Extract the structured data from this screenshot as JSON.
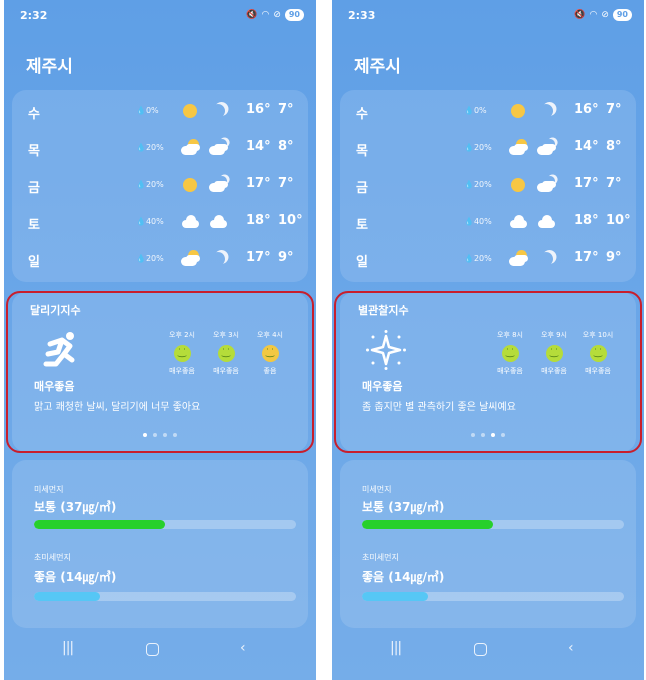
{
  "screens": [
    {
      "status": {
        "time": "2:32",
        "battery": "90"
      },
      "city": "제주시",
      "forecast": [
        {
          "day": "수",
          "rain": "0%",
          "day_icon": "sun-icon",
          "night_icon": "moon-icon",
          "high": "16°",
          "low": "7°"
        },
        {
          "day": "목",
          "rain": "20%",
          "day_icon": "partly-cloudy-icon",
          "night_icon": "cloudy-night-icon",
          "high": "14°",
          "low": "8°"
        },
        {
          "day": "금",
          "rain": "20%",
          "day_icon": "sun-icon",
          "night_icon": "cloudy-night-icon",
          "high": "17°",
          "low": "7°"
        },
        {
          "day": "토",
          "rain": "40%",
          "day_icon": "cloud-icon",
          "night_icon": "cloud-icon",
          "high": "18°",
          "low": "10°"
        },
        {
          "day": "일",
          "rain": "20%",
          "day_icon": "partly-cloudy-icon",
          "night_icon": "moon-icon",
          "high": "17°",
          "low": "9°"
        }
      ],
      "index": {
        "title": "달리기지수",
        "icon": "running-person-icon",
        "slots": [
          {
            "time": "오후 2시",
            "level": "매우좋음"
          },
          {
            "time": "오후 3시",
            "level": "매우좋음"
          },
          {
            "time": "오후 4시",
            "level": "좋음"
          }
        ],
        "verdict": "매우좋음",
        "description": "맑고 쾌청한 날씨, 달리기에 너무 좋아요",
        "page": 1,
        "pages": 4
      },
      "dust": {
        "pm10_label": "미세먼지",
        "pm10_value": "보통 (37㎍/㎥)",
        "pm10_level": 0.5,
        "pm25_label": "초미세먼지",
        "pm25_value": "좋음 (14㎍/㎥)",
        "pm25_level": 0.25
      }
    },
    {
      "status": {
        "time": "2:33",
        "battery": "90"
      },
      "city": "제주시",
      "forecast": [
        {
          "day": "수",
          "rain": "0%",
          "day_icon": "sun-icon",
          "night_icon": "moon-icon",
          "high": "16°",
          "low": "7°"
        },
        {
          "day": "목",
          "rain": "20%",
          "day_icon": "partly-cloudy-icon",
          "night_icon": "cloudy-night-icon",
          "high": "14°",
          "low": "8°"
        },
        {
          "day": "금",
          "rain": "20%",
          "day_icon": "sun-icon",
          "night_icon": "cloudy-night-icon",
          "high": "17°",
          "low": "7°"
        },
        {
          "day": "토",
          "rain": "40%",
          "day_icon": "cloud-icon",
          "night_icon": "cloud-icon",
          "high": "18°",
          "low": "10°"
        },
        {
          "day": "일",
          "rain": "20%",
          "day_icon": "partly-cloudy-icon",
          "night_icon": "moon-icon",
          "high": "17°",
          "low": "9°"
        }
      ],
      "index": {
        "title": "별관찰지수",
        "icon": "sparkle-star-icon",
        "slots": [
          {
            "time": "오후 8시",
            "level": "매우좋음"
          },
          {
            "time": "오후 9시",
            "level": "매우좋음"
          },
          {
            "time": "오후 10시",
            "level": "매우좋음"
          }
        ],
        "verdict": "매우좋음",
        "description": "좀 춥지만 별 관측하기 좋은 날씨예요",
        "page": 3,
        "pages": 4
      },
      "dust": {
        "pm10_label": "미세먼지",
        "pm10_value": "보통 (37㎍/㎥)",
        "pm10_level": 0.5,
        "pm25_label": "초미세먼지",
        "pm25_value": "좋음 (14㎍/㎥)",
        "pm25_level": 0.25
      }
    }
  ],
  "colors": {
    "highlight": "#c81e2c",
    "pm10_bar": "#27d02b",
    "pm25_bar": "#56c7f5",
    "sun": "#f7c744"
  }
}
